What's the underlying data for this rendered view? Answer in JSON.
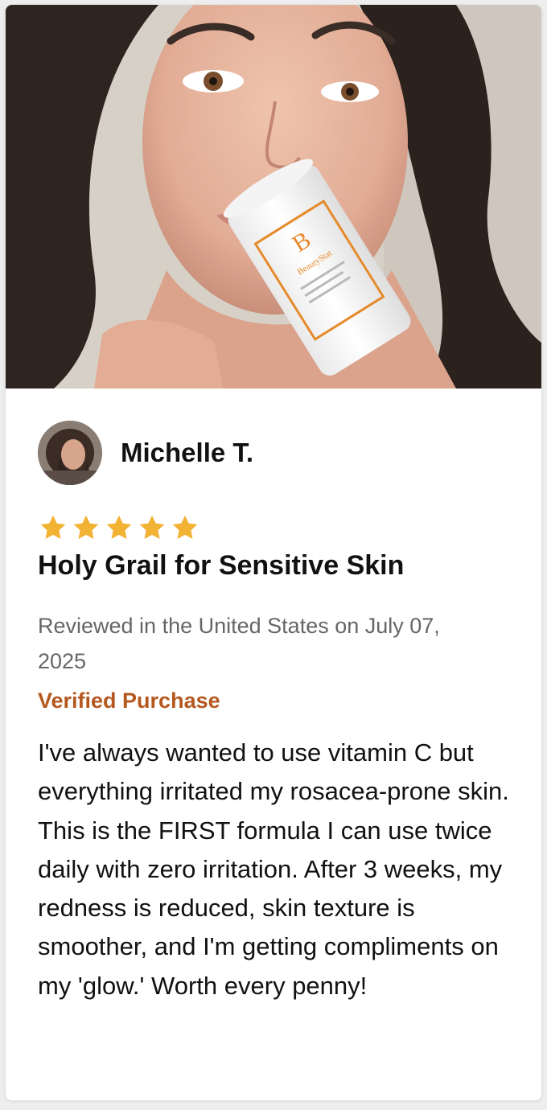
{
  "review": {
    "reviewer_name": "Michelle T.",
    "rating": 5,
    "rating_max": 5,
    "star_color": "#f2b233",
    "title": "Holy Grail for Sensitive Skin",
    "meta": "Reviewed in the United States on July 07, 2025",
    "verified": "Verified Purchase",
    "verified_color": "#b5581f",
    "body": "I've always wanted to use vitamin C but everything irritated my rosacea-prone skin. This is the FIRST formula I can use twice daily with zero irritation. After 3 weeks, my redness is reduced, skin texture is smoother, and I'm getting compliments on my 'glow.' Worth every penny!"
  },
  "photo": {
    "product_logo": "B",
    "product_brand": "BeautyStat"
  }
}
